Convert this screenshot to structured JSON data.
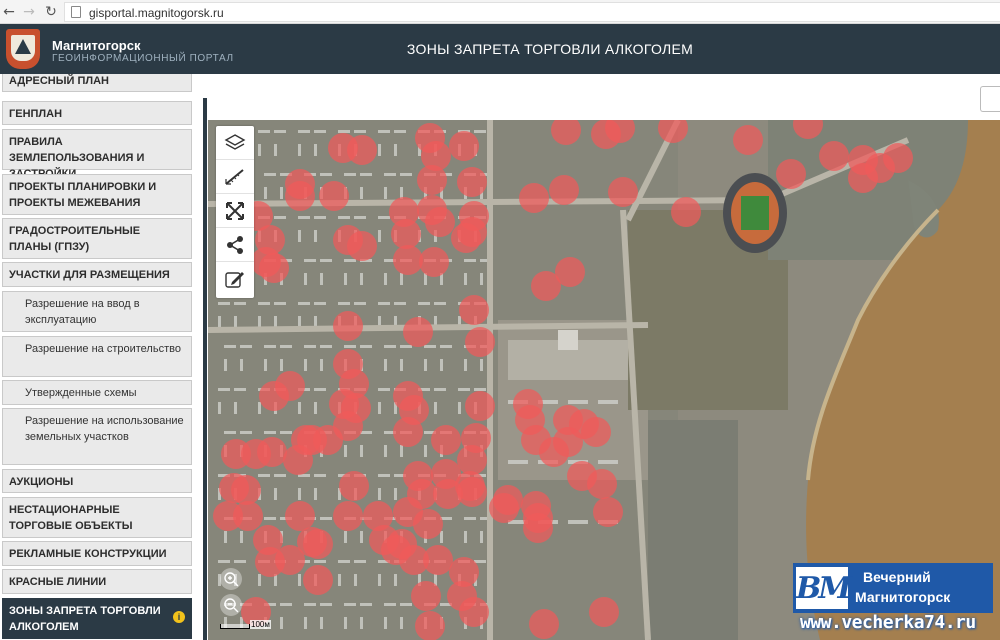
{
  "browser": {
    "url": "gisportal.magnitogorsk.ru",
    "back_icon": "arrow-left-icon",
    "forward_icon": "arrow-right-icon",
    "reload_icon": "reload-icon"
  },
  "header": {
    "brand_name": "Магнитогорск",
    "brand_subtitle": "ГЕОИНФОРМАЦИОННЫЙ ПОРТАЛ",
    "title": "ЗОНЫ ЗАПРЕТА ТОРГОВЛИ АЛКОГОЛЕМ",
    "background": "#2b3a45"
  },
  "sidebar": {
    "items": [
      {
        "label": "АДРЕСНЫЙ ПЛАН",
        "sub": false
      },
      {
        "label": "ГЕНПЛАН",
        "sub": false
      },
      {
        "label": "ПРАВИЛА ЗЕМЛЕПОЛЬЗОВАНИЯ И ЗАСТРОЙКИ",
        "sub": false
      },
      {
        "label": "ПРОЕКТЫ ПЛАНИРОВКИ И ПРОЕКТЫ МЕЖЕВАНИЯ",
        "sub": false
      },
      {
        "label": "ГРАДОСТРОИТЕЛЬНЫЕ ПЛАНЫ (ГПЗУ)",
        "sub": false
      },
      {
        "label": "УЧАСТКИ ДЛЯ РАЗМЕЩЕНИЯ",
        "sub": false
      },
      {
        "label": "Разрешение на ввод в эксплуатацию",
        "sub": true
      },
      {
        "label": "Разрешение на строительство",
        "sub": true
      },
      {
        "label": "Утвержденные схемы",
        "sub": true
      },
      {
        "label": "Разрешение на использование земельных участков",
        "sub": true
      },
      {
        "label": "АУКЦИОНЫ",
        "sub": false
      },
      {
        "label": "НЕСТАЦИОНАРНЫЕ ТОРГОВЫЕ ОБЪЕКТЫ",
        "sub": false
      },
      {
        "label": "РЕКЛАМНЫЕ КОНСТРУКЦИИ",
        "sub": false
      },
      {
        "label": "КРАСНЫЕ ЛИНИИ",
        "sub": false
      },
      {
        "label": "ЗОНЫ ЗАПРЕТА ТОРГОВЛИ АЛКОГОЛЕМ",
        "sub": false,
        "active": true
      }
    ],
    "info_badge": "i"
  },
  "map": {
    "tools": [
      "layers-icon",
      "ruler-icon",
      "fullscreen-icon",
      "share-icon",
      "edit-icon"
    ],
    "zoom_in_icon": "zoom-in-icon",
    "zoom_out_icon": "zoom-out-icon",
    "scale_label": "100м",
    "zone_color": "#f05a5a"
  },
  "watermark": {
    "monogram": "ВМ",
    "line1": "Вечерний",
    "line2": "Магнитогорск",
    "url": "www.vecherka74.ru",
    "color": "#1f59a8"
  }
}
